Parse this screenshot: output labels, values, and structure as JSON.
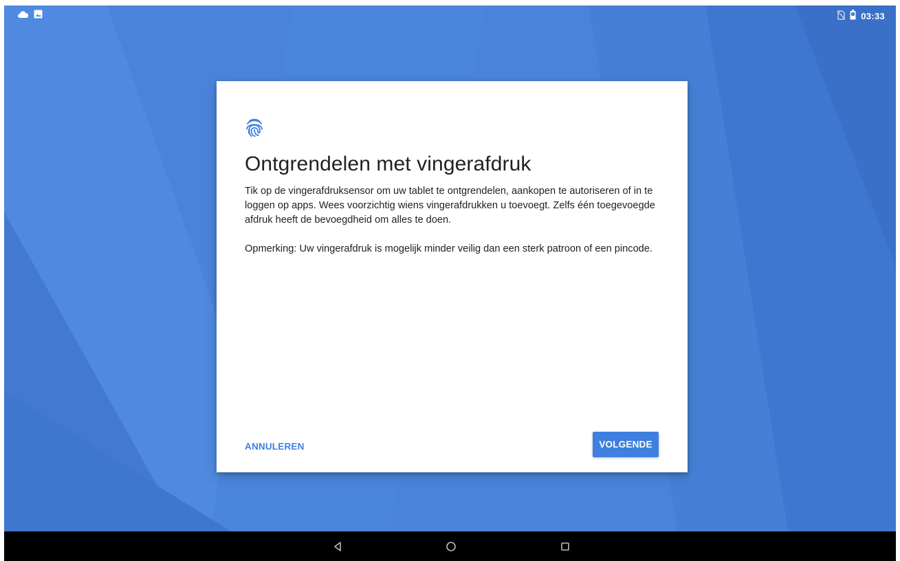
{
  "status_bar": {
    "time": "03:33",
    "left_icons": [
      "cloud-icon",
      "image-icon"
    ],
    "right_icons": [
      "no-sim-icon",
      "battery-icon"
    ]
  },
  "dialog": {
    "icon": "fingerprint-icon",
    "title": "Ontgrendelen met vingerafdruk",
    "paragraph1": "Tik op de vingerafdruksensor om uw tablet te ontgrendelen, aankopen te autoriseren of in te loggen op apps. Wees voorzichtig wiens vingerafdrukken u toevoegt. Zelfs één toegevoegde afdruk heeft de bevoegdheid om alles te doen.",
    "paragraph2": "Opmerking: Uw vingerafdruk is mogelijk minder veilig dan een sterk patroon of een pincode.",
    "cancel_label": "ANNULEREN",
    "next_label": "VOLGENDE"
  },
  "nav_bar": {
    "buttons": [
      "back-icon",
      "home-icon",
      "recents-icon"
    ]
  },
  "colors": {
    "wallpaper": "#4a82d8",
    "accent": "#3e7fe0",
    "dialog_bg": "#ffffff",
    "nav_bg": "#000000"
  }
}
